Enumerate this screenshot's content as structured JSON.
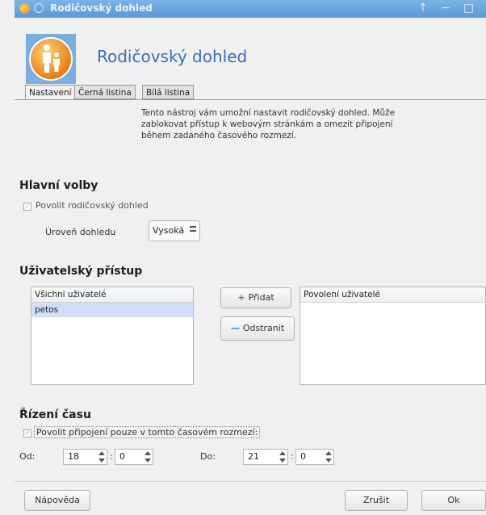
{
  "window": {
    "title": "Rodičovský dohled",
    "controls": [
      "↑",
      "−",
      "□"
    ]
  },
  "header": {
    "title": "Rodičovský dohled",
    "logo_icon": "family-parental-icon",
    "accent_color": "#f08a1c"
  },
  "tabs": [
    {
      "label": "Nastavení",
      "active": true
    },
    {
      "label": "Černá listina",
      "active": false
    },
    {
      "label": "Bílá listina",
      "active": false
    }
  ],
  "description": "Tento nástroj vám umožní nastavit rodičovský dohled. Může zablokovat přístup k webovým stránkám a omezit připojení během zadaného časového rozmezí.",
  "main_options": {
    "heading": "Hlavní volby",
    "enable_label": "Povolit rodičovský dohled",
    "enable_checked": true,
    "level_label": "Úroveň dohledu",
    "level_value": "Vysoká"
  },
  "user_access": {
    "heading": "Uživatelský přístup",
    "all_users_header": "Všichni uživatelé",
    "all_users": [
      "petos"
    ],
    "add_label": "Přidat",
    "remove_label": "Odstranit",
    "allowed_users_header": "Povolení uživatelé",
    "allowed_users": []
  },
  "time_control": {
    "heading": "Řízení času",
    "enable_label": "Povolit připojení pouze v tomto časovém rozmezí:",
    "enable_checked": true,
    "from_label": "Od:",
    "from_hour": "18",
    "from_minute": "0",
    "to_label": "Do:",
    "to_hour": "21",
    "to_minute": "0",
    "separator": ":"
  },
  "footer": {
    "help_label": "Nápověda",
    "cancel_label": "Zrušit",
    "ok_label": "Ok"
  }
}
